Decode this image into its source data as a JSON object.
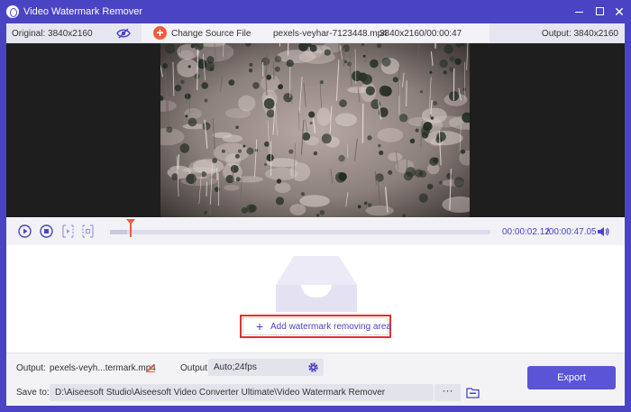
{
  "window": {
    "title": "Video Watermark Remover",
    "accent_color": "#4a44c4",
    "highlight_color": "#f25a3c"
  },
  "infobar": {
    "original_label": "Original: 3840x2160",
    "change_source_label": "Change Source File",
    "file_name": "pexels-veyhar-7123448.mp4",
    "file_meta": "3840x2160/00:00:47",
    "output_label": "Output: 3840x2160"
  },
  "playback": {
    "current_time": "00:00:02.12",
    "total_time": "/00:00:47.05",
    "progress_fraction": 0.045
  },
  "work_area": {
    "add_area_label": "Add watermark removing area"
  },
  "bottom": {
    "output_label": "Output:",
    "output_file": "pexels-veyh...termark.mp4",
    "output_setting_label": "Output:",
    "output_setting_value": "Auto;24fps",
    "save_to_label": "Save to:",
    "save_path": "D:\\Aiseesoft Studio\\Aiseesoft Video Converter Ultimate\\Video Watermark Remover",
    "browse_label": "···",
    "export_label": "Export"
  },
  "icons": {
    "app": "app-logo-icon",
    "eye": "eye-slash-icon",
    "play": "play-icon",
    "stop": "stop-icon",
    "trim_start": "trim-start-icon",
    "trim_end": "trim-end-icon",
    "volume": "volume-icon",
    "inbox": "inbox-icon",
    "edit": "pencil-icon",
    "gear": "gear-icon",
    "folder": "folder-icon"
  }
}
